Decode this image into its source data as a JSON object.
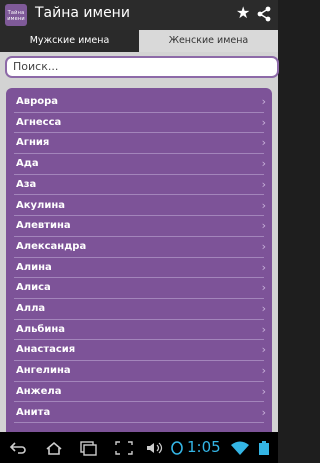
{
  "app": {
    "icon_text": "Тайна имени",
    "title": "Тайна имени"
  },
  "tabs": [
    {
      "label": "Мужские имена",
      "selected": false
    },
    {
      "label": "Женские имена",
      "selected": true
    }
  ],
  "search": {
    "placeholder": "Поиск..."
  },
  "names": [
    "Аврора",
    "Агнесса",
    "Агния",
    "Ада",
    "Аза",
    "Акулина",
    "Алевтина",
    "Александра",
    "Алина",
    "Алиса",
    "Алла",
    "Альбина",
    "Анастасия",
    "Ангелина",
    "Анжела",
    "Анита"
  ],
  "chevron": "›",
  "status": {
    "time": "1:05"
  },
  "colors": {
    "accent": "#7d5398",
    "search_border": "#8d6aa8",
    "clock": "#34b5e5"
  }
}
